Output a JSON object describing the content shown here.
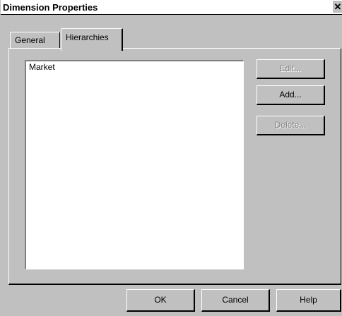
{
  "window": {
    "title": "Dimension Properties",
    "close_glyph": "✕"
  },
  "tabs": [
    {
      "label": "General",
      "selected": false
    },
    {
      "label": "Hierarchies",
      "selected": true
    }
  ],
  "hierarchies": {
    "items": [
      "Market"
    ]
  },
  "side_buttons": {
    "edit": {
      "label": "Edit...",
      "enabled": false
    },
    "add": {
      "label": "Add...",
      "enabled": true
    },
    "delete": {
      "label": "Delete...",
      "enabled": false
    }
  },
  "footer": {
    "ok": "OK",
    "cancel": "Cancel",
    "help": "Help"
  }
}
